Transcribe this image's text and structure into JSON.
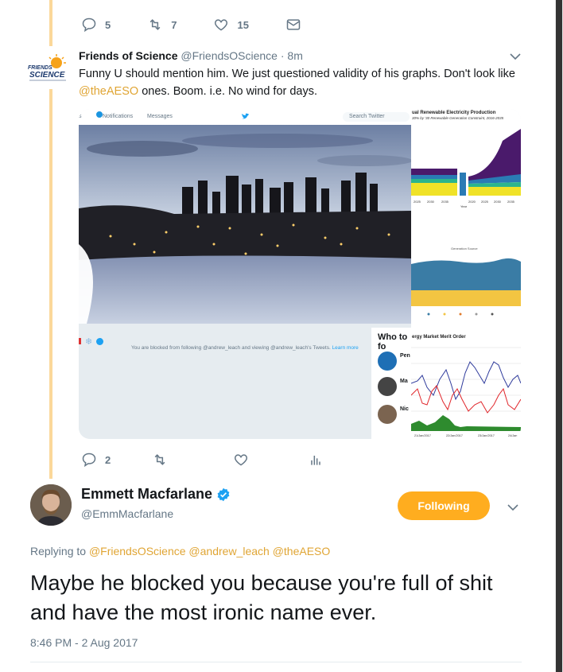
{
  "top_tweet_actions": {
    "reply_count": "5",
    "retweet_count": "7",
    "like_count": "15"
  },
  "quoted_tweet": {
    "author_name": "Friends of Science",
    "author_handle": "@FriendsOScience",
    "time_sep": "·",
    "time": "8m",
    "logo_text_top": "FRIENDS",
    "logo_text_bottom": "SCIENCE",
    "text_before": "Funny U should mention him. We just questioned validity of his graphs. Don't look like ",
    "mention": "@theAESO",
    "text_after": " ones. Boom. i.e. No wind for days.",
    "media": {
      "nav_notifications": "Notifications",
      "nav_messages": "Messages",
      "nav_search": "Search Twitter",
      "blocked_text": "You are blocked from following @andrew_leach and viewing @andrew_leach's Tweets.",
      "learn_more": "Learn more",
      "who_to_follow": "Who to fo",
      "chart1_title": "ual Renewable Electricity Production",
      "chart1_subtitle": "30% by '30 Renewable Generation Constraint, 2016-2035",
      "chart1_xlabels": [
        "2025",
        "2030",
        "2035",
        "2020",
        "2025",
        "2030",
        "2035"
      ],
      "chart1_xlabel": "Year",
      "chart2_title": "Generation Source",
      "chart3_title": "ergy Market Merit Order",
      "chart3_xlabels": [
        "21/Jan/2017",
        "22/Jan/2017",
        "23/Jan/2017",
        "24/Jan"
      ],
      "who_items": [
        "Pen",
        "Ma",
        "Nic"
      ]
    },
    "actions": {
      "reply_count": "2"
    }
  },
  "reply": {
    "name": "Emmett Macfarlane",
    "handle": "@EmmMacfarlane",
    "follow_label": "Following",
    "replying_label": "Replying to",
    "replying_to": [
      "@FriendsOScience",
      "@andrew_leach",
      "@theAESO"
    ],
    "text": "Maybe he blocked you because you're full of shit and have the most ironic name ever.",
    "timestamp": "8:46 PM - 2 Aug 2017"
  },
  "colors": {
    "accent": "#ffad1f",
    "mention": "#e0a534",
    "thread_line": "#fbd89a",
    "muted": "#657786"
  }
}
